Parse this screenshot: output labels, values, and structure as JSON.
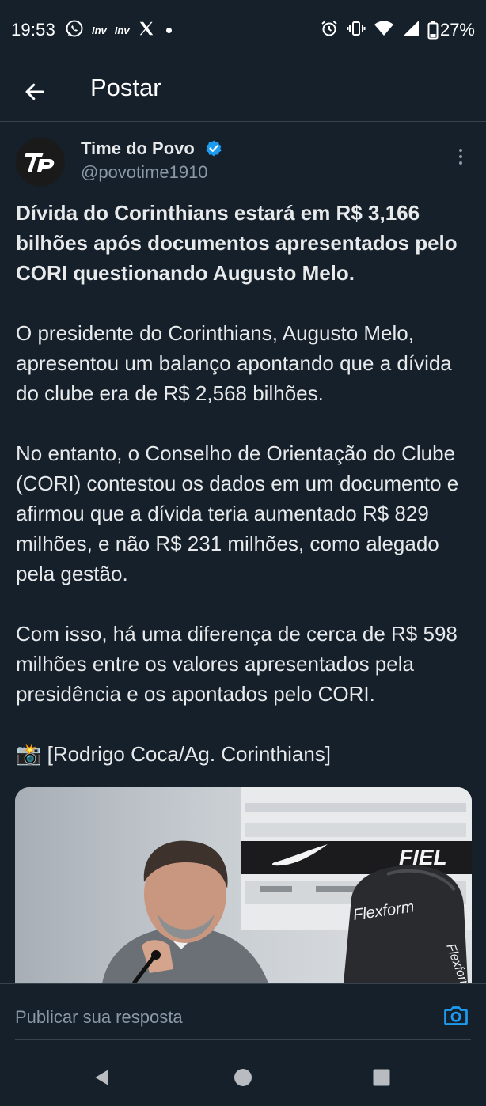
{
  "status_bar": {
    "time": "19:53",
    "notification_icons": [
      "whatsapp-icon",
      "inv-icon",
      "inv-icon",
      "x-icon",
      "dot-icon"
    ],
    "inv_label_1": "Inv",
    "inv_label_2": "Inv",
    "right_icons": [
      "alarm-icon",
      "vibrate-icon",
      "wifi-icon",
      "signal-icon",
      "battery-icon"
    ],
    "battery": "27%"
  },
  "top_bar": {
    "back_icon": "arrow-left-icon",
    "title": "Postar"
  },
  "post": {
    "author_name": "Time do Povo",
    "verified": true,
    "handle": "@povotime1910",
    "avatar_text": "TP",
    "more_icon": "more-vertical-icon",
    "headline": "Dívida do Corinthians estará em R$ 3,166 bilhões após documentos apresentados pelo CORI questionando Augusto Melo.",
    "paragraph_1": "O presidente do Corinthians, Augusto Melo, apresentou um balanço apontando que a dívida do clube era de R$ 2,568 bilhões.",
    "paragraph_2": "No entanto, o Conselho de Orientação do Clube (CORI) contestou os dados em um documento e afirmou que a dívida teria aumentado R$ 829 milhões, e não R$ 231 milhões, como alegado pela gestão.",
    "paragraph_3": "Com isso, há uma diferença de cerca de R$ 598 milhões entre os valores apresentados pela presidência e os apontados pelo CORI.",
    "credit": "📸 [Rodrigo Coca/Ag. Corinthians]",
    "image": {
      "brand_text_1": "Flexform",
      "brand_text_2": "Flexform",
      "sponsor_text": "FIEL"
    }
  },
  "reply_bar": {
    "placeholder": "Publicar sua resposta",
    "camera_icon": "camera-icon"
  },
  "nav_bar": {
    "icons": [
      "back-triangle-icon",
      "home-circle-icon",
      "recents-square-icon"
    ]
  },
  "colors": {
    "background": "#15202b",
    "text": "#e7e9ea",
    "secondary_text": "#8b98a5",
    "accent": "#1d9bf0",
    "divider": "#38444d"
  }
}
